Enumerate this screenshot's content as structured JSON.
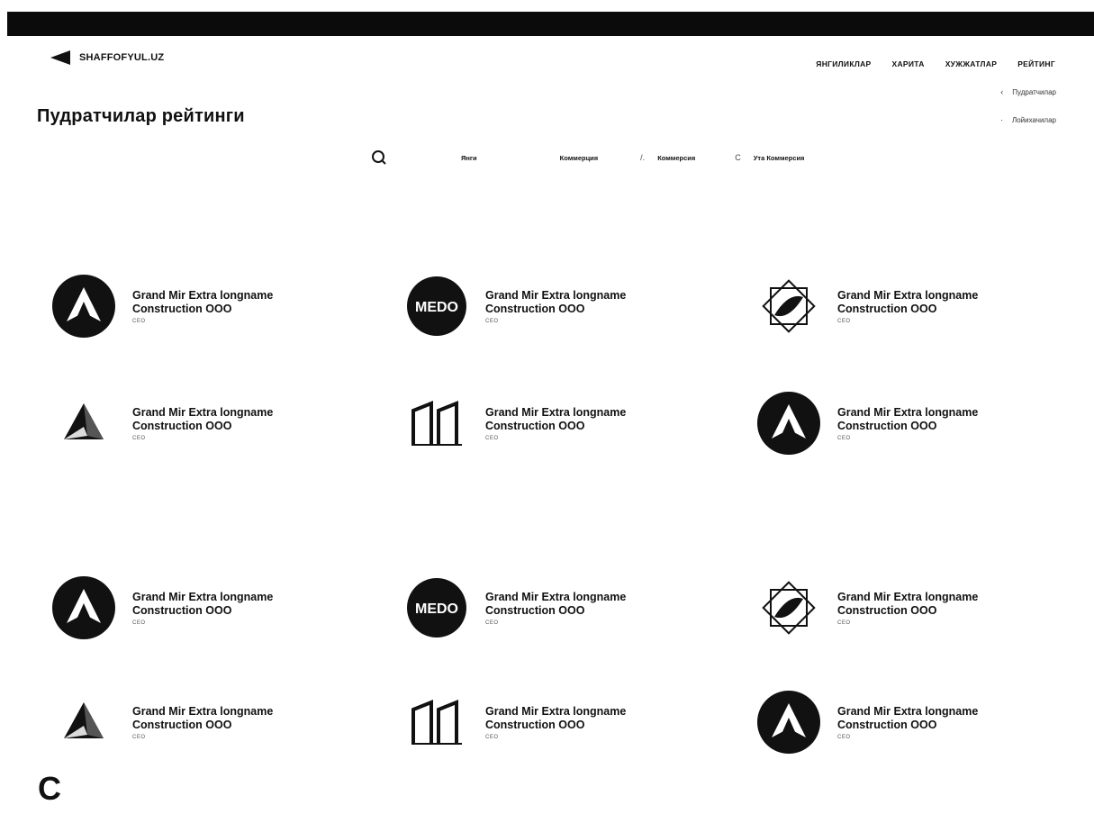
{
  "topbar": {
    "phone": "​",
    "account": "​"
  },
  "brand": {
    "name": "SHAFFOFYUL.UZ"
  },
  "nav": {
    "items": [
      "ЯНГИЛИКЛАР",
      "ХАРИТА",
      "ХУЖЖАТЛАР",
      "РЕЙТИНГ"
    ]
  },
  "side_links": [
    {
      "label": "Пудратчилар"
    },
    {
      "label": "Лойихачилар"
    }
  ],
  "page": {
    "title": "Пудратчилар рейтинги"
  },
  "filters": {
    "items": [
      "Янги",
      "Коммерция",
      "Коммерсия",
      "Ута Коммерсия"
    ]
  },
  "cards": [
    {
      "logo": "peak-circle-icon",
      "name_line1": "Grand Mir Extra longname",
      "name_line2": "Construction OOO",
      "sub": "CEO"
    },
    {
      "logo": "medo-logo",
      "logo_text": "MEDO",
      "name_line1": "Grand Mir Extra longname",
      "name_line2": "Construction OOO",
      "sub": "CEO"
    },
    {
      "logo": "diamond-star-icon",
      "name_line1": "Grand Mir Extra longname",
      "name_line2": "Construction OOO",
      "sub": "CEO"
    },
    {
      "logo": "triangle-prism-icon",
      "name_line1": "Grand Mir Extra longname",
      "name_line2": "Construction OOO",
      "sub": "CEO"
    },
    {
      "logo": "buildings-m-icon",
      "name_line1": "Grand Mir Extra longname",
      "name_line2": "Construction OOO",
      "sub": "CEO"
    },
    {
      "logo": "peak-circle-icon",
      "name_line1": "Grand Mir Extra longname",
      "name_line2": "Construction OOO",
      "sub": "CEO"
    },
    {
      "logo": "peak-circle-icon",
      "name_line1": "Grand Mir Extra longname",
      "name_line2": "Construction OOO",
      "sub": "CEO"
    },
    {
      "logo": "medo-logo",
      "logo_text": "MEDO",
      "name_line1": "Grand Mir Extra longname",
      "name_line2": "Construction OOO",
      "sub": "CEO"
    },
    {
      "logo": "diamond-star-icon",
      "name_line1": "Grand Mir Extra longname",
      "name_line2": "Construction OOO",
      "sub": "CEO"
    },
    {
      "logo": "triangle-prism-icon",
      "name_line1": "Grand Mir Extra longname",
      "name_line2": "Construction OOO",
      "sub": "CEO"
    },
    {
      "logo": "buildings-m-icon",
      "name_line1": "Grand Mir Extra longname",
      "name_line2": "Construction OOO",
      "sub": "CEO"
    },
    {
      "logo": "peak-circle-icon",
      "name_line1": "Grand Mir Extra longname",
      "name_line2": "Construction OOO",
      "sub": "CEO"
    }
  ],
  "more": {
    "label": "C"
  },
  "colors": {
    "topbar": "#0b0b0b",
    "text": "#111111"
  }
}
